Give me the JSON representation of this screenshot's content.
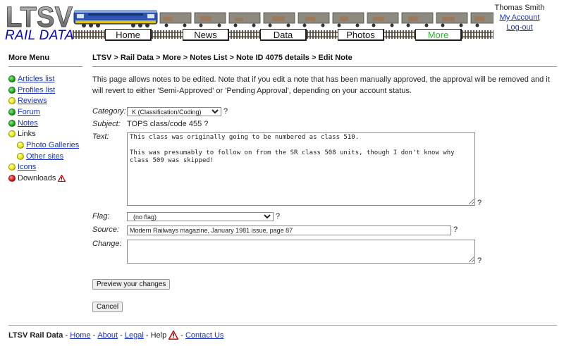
{
  "header": {
    "logo_text": "LTSV",
    "logo_subtitle": "RAIL DATA",
    "nav": [
      {
        "label": "Home",
        "active": false
      },
      {
        "label": "News",
        "active": false
      },
      {
        "label": "Data",
        "active": false
      },
      {
        "label": "Photos",
        "active": false
      },
      {
        "label": "More",
        "active": true
      }
    ],
    "account": {
      "user_name": "Thomas Smith",
      "my_account": "My Account",
      "logout": "Log-out"
    },
    "colors": {
      "logo_blue": "#0000cc",
      "nav_active": "#2bb52b",
      "link": "#1a35c0"
    }
  },
  "sidebar": {
    "title": "More Menu",
    "items": [
      {
        "label": "Articles list",
        "status": "green",
        "link": true,
        "sub": false
      },
      {
        "label": "Profiles list",
        "status": "green",
        "link": true,
        "sub": false
      },
      {
        "label": "Reviews",
        "status": "yellow",
        "link": true,
        "sub": false
      },
      {
        "label": "Forum",
        "status": "green",
        "link": true,
        "sub": false
      },
      {
        "label": "Notes",
        "status": "green",
        "link": true,
        "sub": false
      },
      {
        "label": "Links",
        "status": "yellow",
        "link": false,
        "sub": false
      },
      {
        "label": "Photo Galleries",
        "status": "yellow",
        "link": true,
        "sub": true
      },
      {
        "label": "Other sites",
        "status": "yellow",
        "link": true,
        "sub": true
      },
      {
        "label": "Icons",
        "status": "yellow",
        "link": true,
        "sub": false
      },
      {
        "label": "Downloads",
        "status": "red",
        "link": false,
        "sub": false,
        "warning_icon": true
      }
    ]
  },
  "main": {
    "breadcrumb": "LTSV > Rail Data > More > Notes List > Note ID 4075 details > Edit Note",
    "intro": "This page allows notes to be edited. Note that if you edit a note that has been manually approved, the approval will be removed and it will revert to either 'Semi-Approved' or 'Pending Approval', depending on your account status.",
    "form": {
      "category_label": "Category:",
      "category_value": "K (Classification/Coding)",
      "subject_label": "Subject:",
      "subject_value": "TOPS class/code 455",
      "text_label": "Text:",
      "text_value": "This class was originally going to be numbered as class 510.\n\nThis was presumably to follow on from the SR class 508 units, though I don't know why class 509 was skipped!",
      "flag_label": "Flag:",
      "flag_value": "(no flag)",
      "source_label": "Source:",
      "source_value": "Modern Railways magazine, January 1981 issue, page 87",
      "change_label": "Change:",
      "change_value": "",
      "help_mark": "?"
    },
    "preview_button": "Preview your changes",
    "cancel_button": "Cancel"
  },
  "footer": {
    "site": "LTSV Rail Data",
    "sep": " - ",
    "home": "Home",
    "about": "About",
    "legal": "Legal",
    "help": "Help",
    "contact": "Contact Us"
  }
}
